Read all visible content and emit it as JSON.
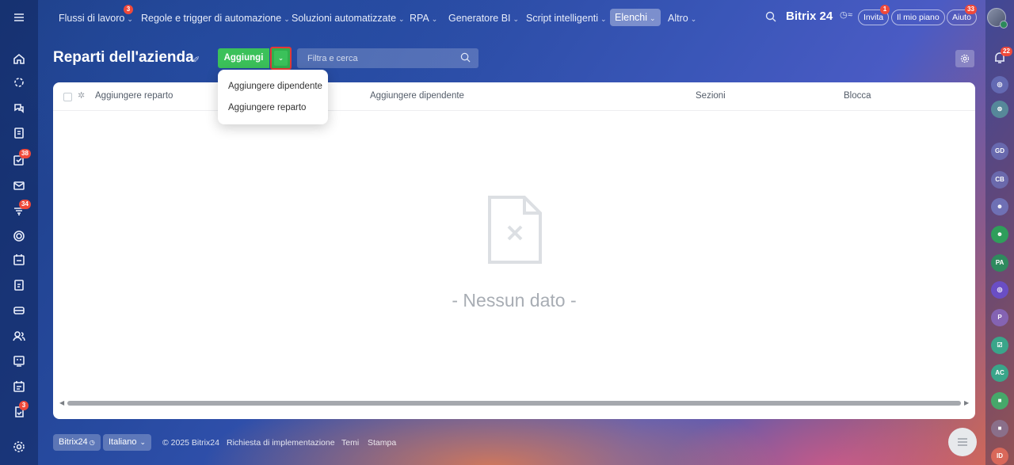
{
  "nav": {
    "items": [
      {
        "label": "Flussi di lavoro",
        "badge": "3"
      },
      {
        "label": "Regole e trigger di automazione"
      },
      {
        "label": "Soluzioni automatizzate"
      },
      {
        "label": "RPA"
      },
      {
        "label": "Generatore BI"
      },
      {
        "label": "Script intelligenti"
      },
      {
        "label": "Elenchi",
        "active": true
      },
      {
        "label": "Altro"
      }
    ],
    "brand": "Bitrix 24",
    "invite_label": "Invita",
    "invite_badge": "1",
    "plan_label": "Il mio piano",
    "help_label": "Aiuto",
    "help_badge": "33"
  },
  "left_sidebar": {
    "badges": {
      "tasks": "38",
      "feed": "34",
      "approvals": "3"
    }
  },
  "right_sidebar": {
    "notification_badge": "22",
    "avatars": [
      "GD",
      "CB",
      "PA",
      "P",
      "AC",
      "ID"
    ]
  },
  "page": {
    "title": "Reparti dell'azienda",
    "add_button": "Aggiungi",
    "search_placeholder": "Filtra e cerca"
  },
  "table": {
    "columns": [
      "Aggiungere reparto",
      "Aggiungere dipendente",
      "Sezioni",
      "Blocca"
    ],
    "empty_text": "- Nessun dato -"
  },
  "dropdown": {
    "items": [
      "Aggiungere dipendente",
      "Aggiungere reparto"
    ]
  },
  "footer": {
    "brand": "Bitrix24",
    "language": "Italiano",
    "copyright": "© 2025 Bitrix24",
    "links": [
      "Richiesta di implementazione",
      "Temi",
      "Stampa"
    ]
  },
  "colors": {
    "accent_green": "#3bc15a",
    "highlight_red": "#e53935",
    "badge_red": "#f0493a"
  }
}
